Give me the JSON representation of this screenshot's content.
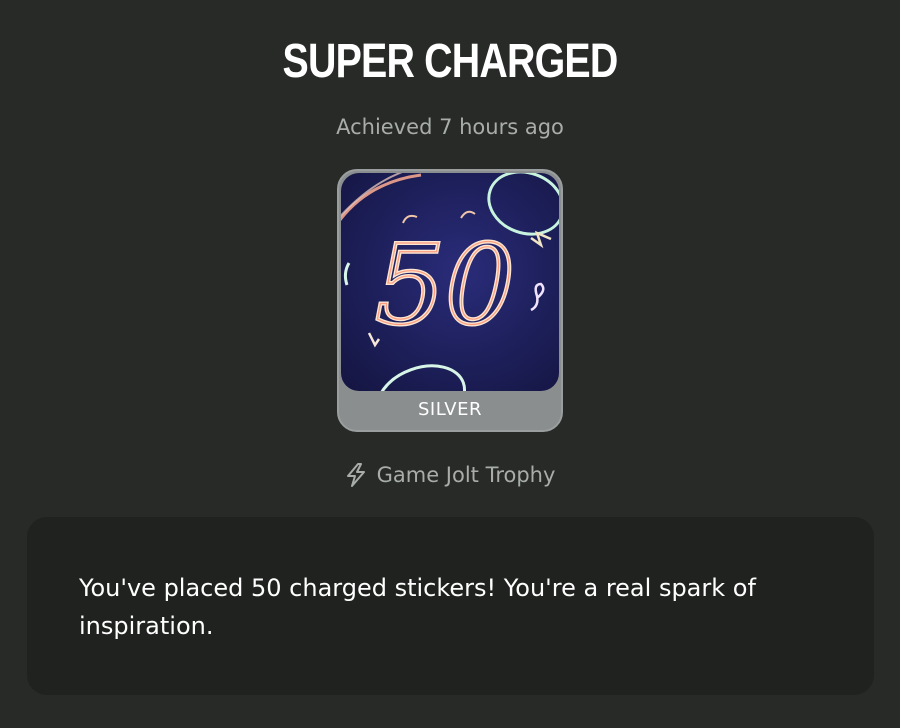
{
  "trophy": {
    "title": "SUPER CHARGED",
    "achieved": "Achieved 7 hours ago",
    "tier": "SILVER",
    "art_text": "50",
    "source_icon": "lightning-bolt-icon",
    "source_label": "Game Jolt Trophy",
    "description": "You've placed 50 charged stickers! You're a real spark of inspiration."
  },
  "colors": {
    "background": "#272a27",
    "card": "#1f221f",
    "muted_text": "#a9ada9",
    "tier_frame": "#8a8e8e",
    "art_background": "#1d1f5a"
  }
}
